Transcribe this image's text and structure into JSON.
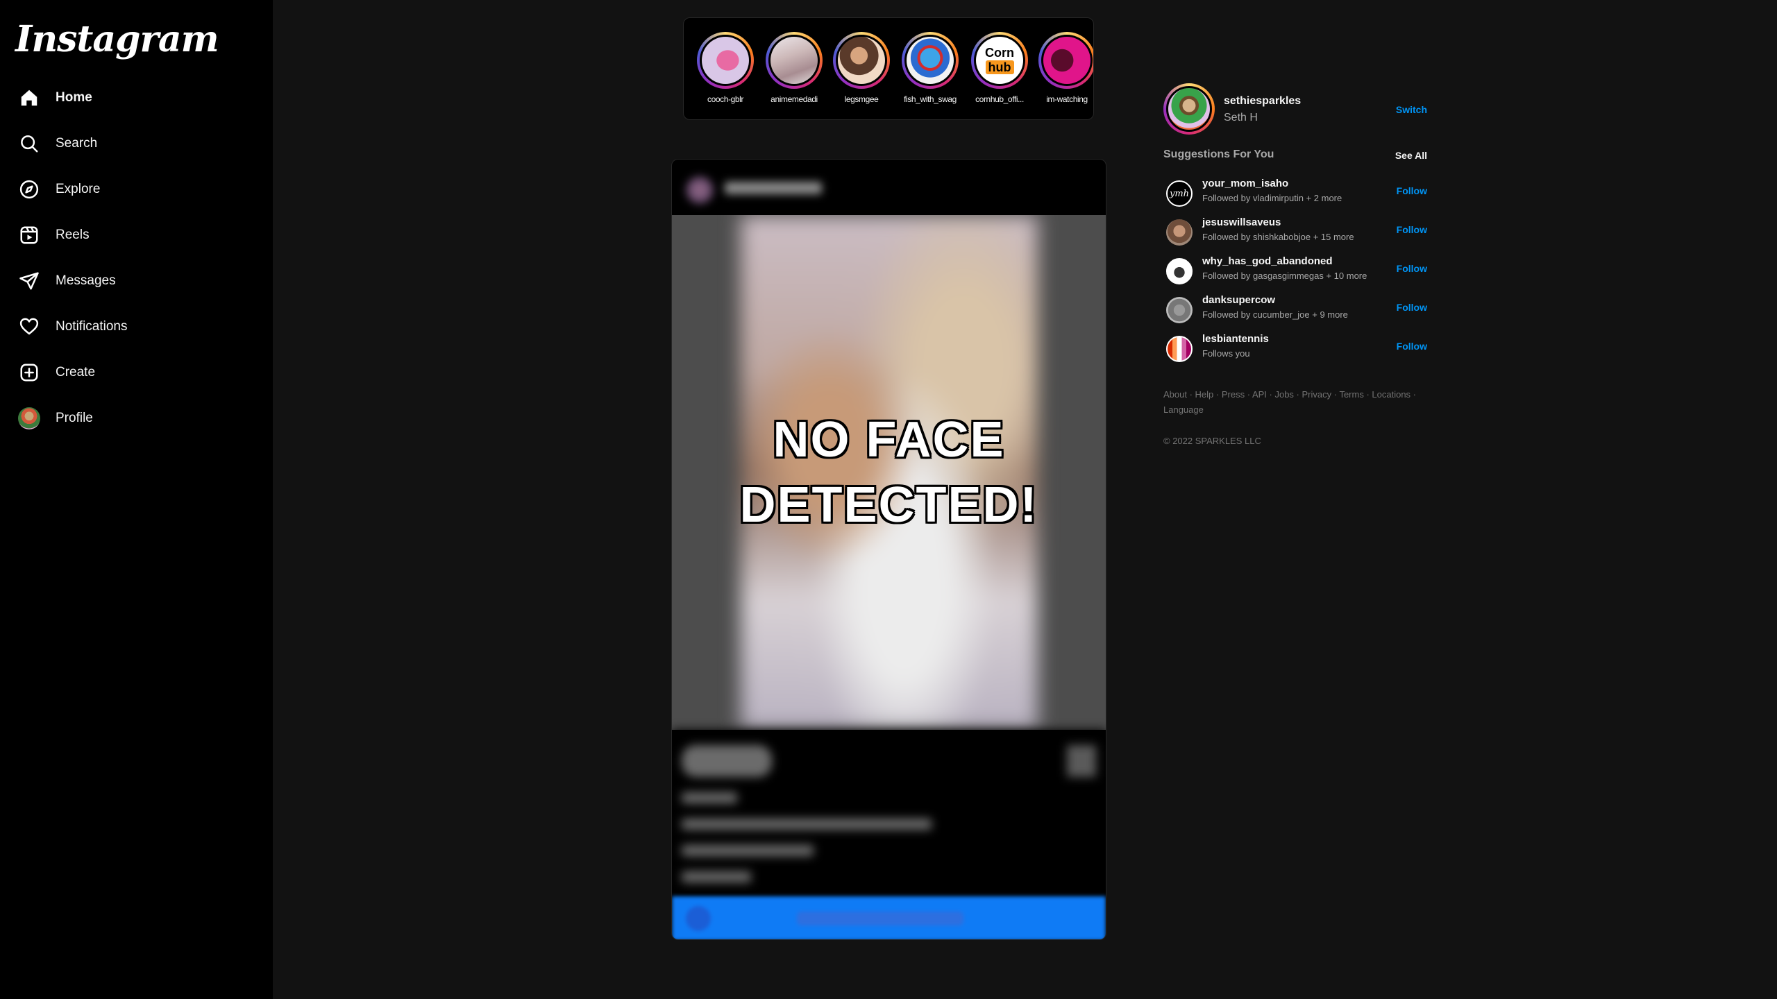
{
  "app": {
    "logo": "Instagram"
  },
  "sidebar": {
    "items": [
      {
        "label": "Home",
        "icon": "home-icon",
        "active": true
      },
      {
        "label": "Search",
        "icon": "search-icon"
      },
      {
        "label": "Explore",
        "icon": "compass-icon"
      },
      {
        "label": "Reels",
        "icon": "reels-icon"
      },
      {
        "label": "Messages",
        "icon": "send-icon"
      },
      {
        "label": "Notifications",
        "icon": "heart-icon"
      },
      {
        "label": "Create",
        "icon": "plus-square-icon"
      },
      {
        "label": "Profile",
        "icon": "avatar"
      }
    ]
  },
  "stories": [
    {
      "username": "cooch-gblr"
    },
    {
      "username": "animemedadi"
    },
    {
      "username": "legsmgee"
    },
    {
      "username": "fish_with_swag"
    },
    {
      "username": "cornhub_offi...",
      "logo_top": "Corn",
      "logo_bottom": "hub"
    },
    {
      "username": "im-watching"
    }
  ],
  "post": {
    "overlay_text": "NO FACE DETECTED!"
  },
  "profile": {
    "username": "sethiesparkles",
    "full_name": "Seth H",
    "switch_label": "Switch"
  },
  "suggestions": {
    "title": "Suggestions For You",
    "see_all": "See All",
    "follow_label": "Follow",
    "items": [
      {
        "username": "your_mom_isaho",
        "subtitle": "Followed by vladimirputin + 2 more",
        "avatar_text": "ymh"
      },
      {
        "username": "jesuswillsaveus",
        "subtitle": "Followed by shishkabobjoe + 15 more"
      },
      {
        "username": "why_has_god_abandoned",
        "subtitle": "Followed by gasgasgimmegas + 10 more"
      },
      {
        "username": "danksupercow",
        "subtitle": "Followed by cucumber_joe + 9 more"
      },
      {
        "username": "lesbiantennis",
        "subtitle": "Follows you"
      }
    ]
  },
  "footer": {
    "links": [
      "About",
      "Help",
      "Press",
      "API",
      "Jobs",
      "Privacy",
      "Terms",
      "Locations",
      "Language"
    ],
    "copyright": "© 2022 SPARKLES LLC"
  },
  "colors": {
    "accent": "#0095f6",
    "background": "#121212",
    "sidebar": "#000000"
  }
}
